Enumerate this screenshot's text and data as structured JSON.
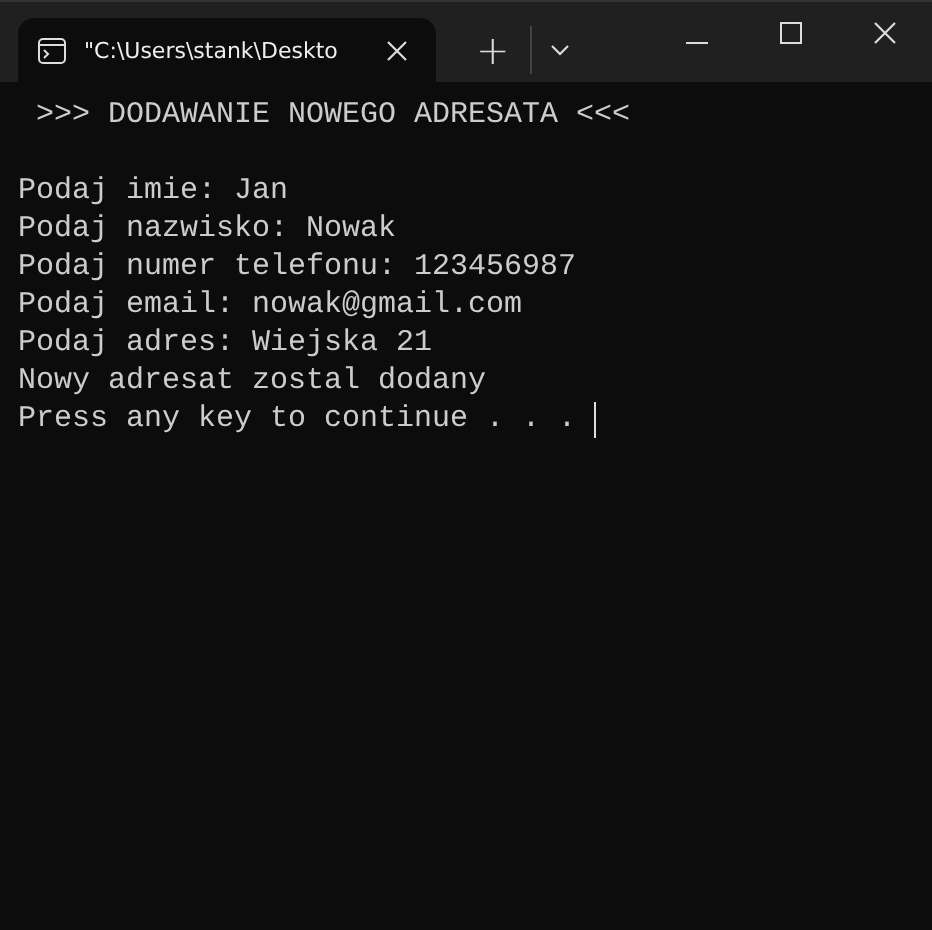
{
  "tab": {
    "title": "\"C:\\Users\\stank\\Deskto",
    "selected": true
  },
  "new_tab": "+",
  "console": {
    "heading": ">>> DODAWANIE NOWEGO ADRESATA <<<",
    "lines": [
      "Podaj imie: Jan",
      "Podaj nazwisko: Nowak",
      "Podaj numer telefonu: 123456987",
      "Podaj email: nowak@gmail.com",
      "Podaj adres: Wiejska 21",
      "Nowy adresat zostal dodany",
      "Press any key to continue . . . "
    ]
  }
}
